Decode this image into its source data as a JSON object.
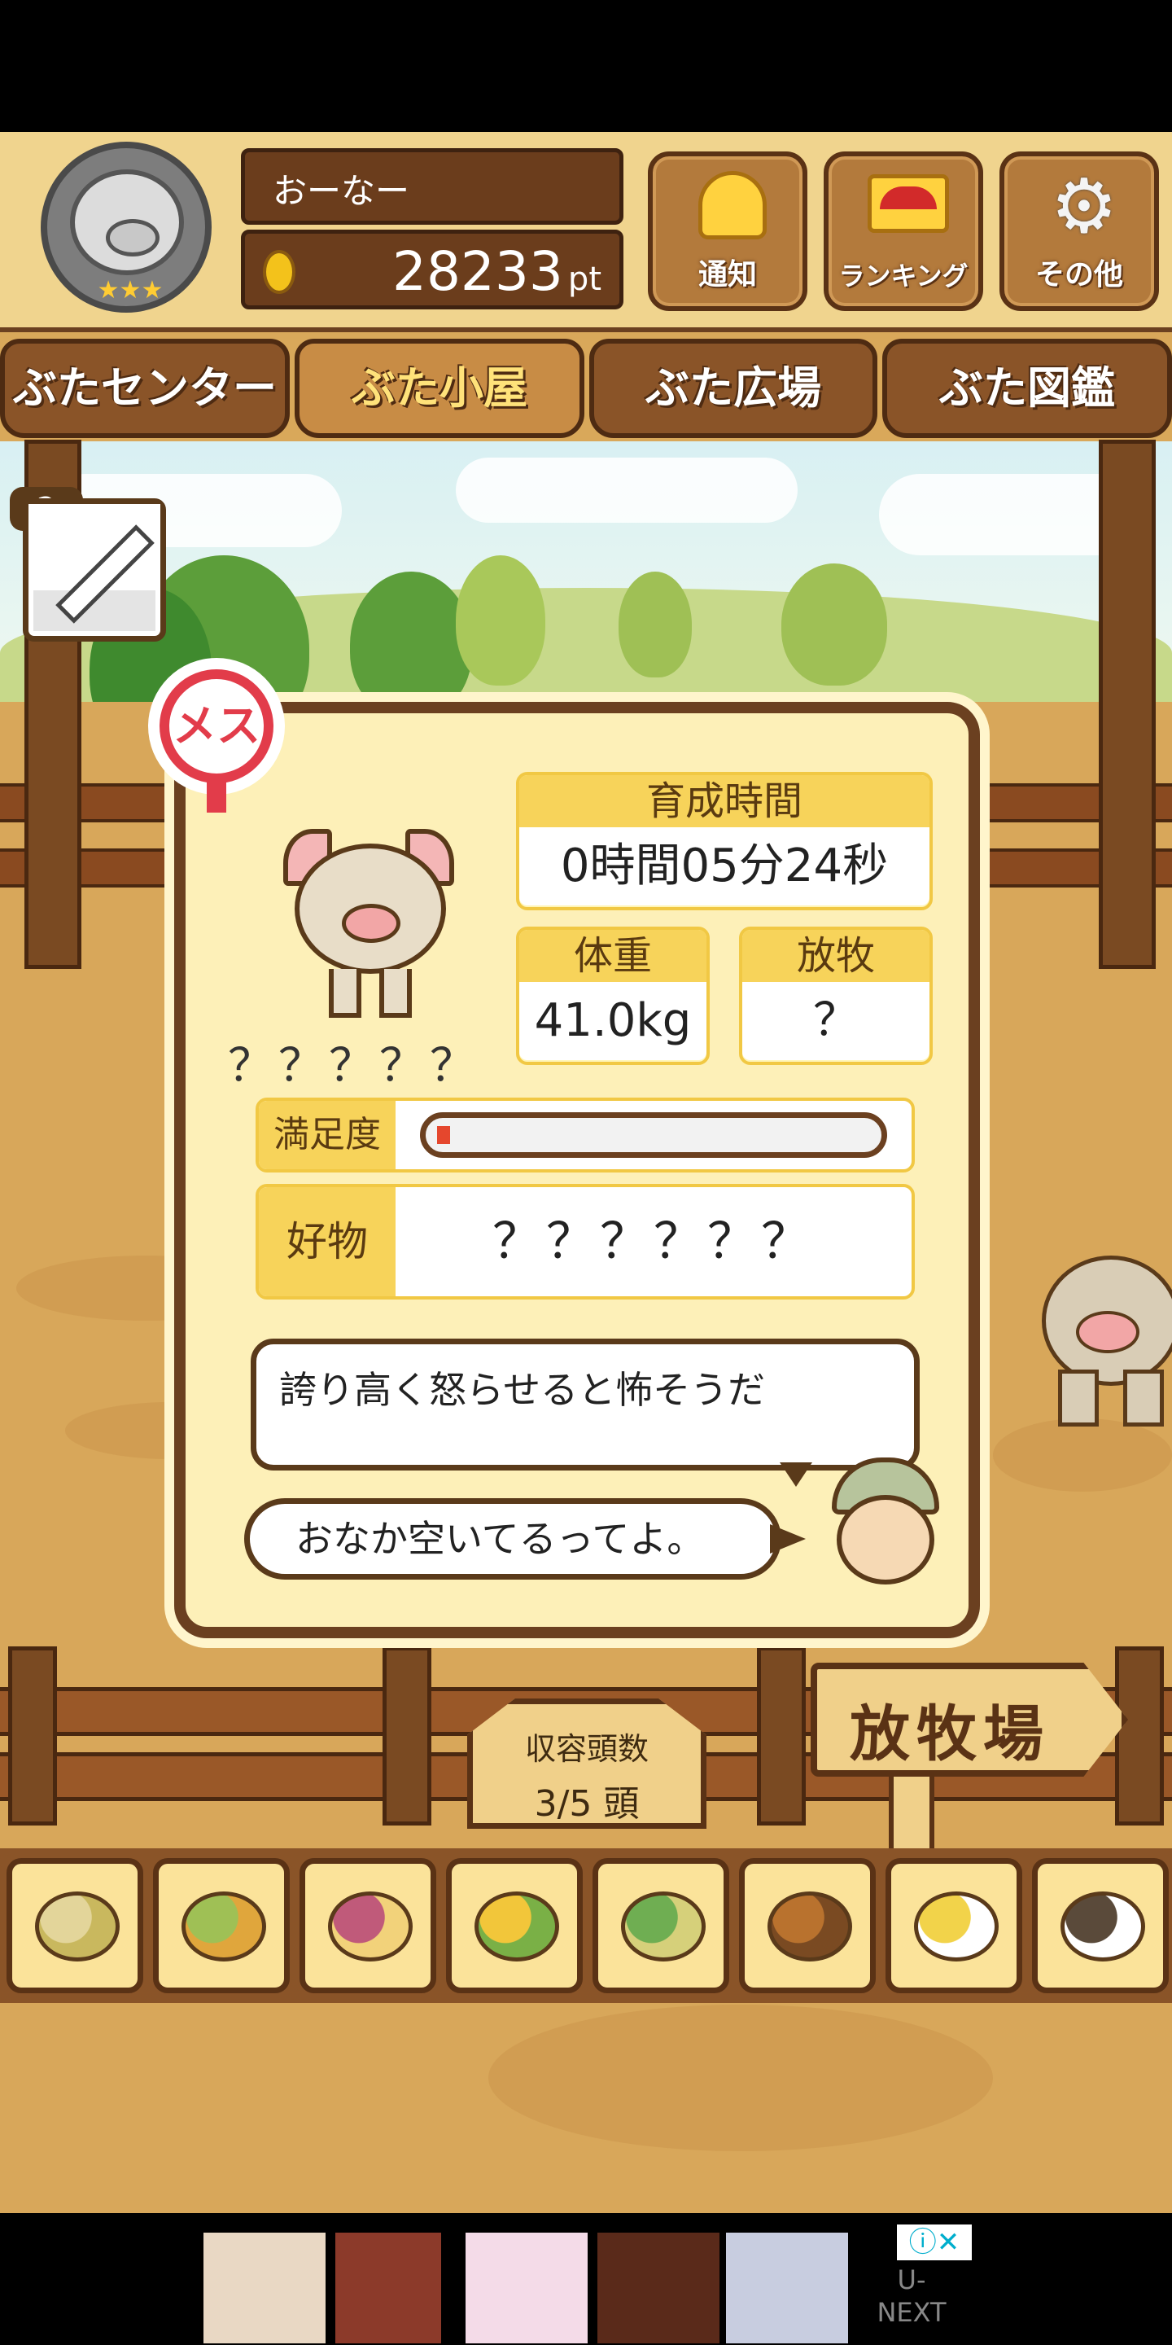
{
  "header": {
    "player_name": "おーなー",
    "points": "28233",
    "points_unit": "pt",
    "buttons": [
      {
        "id": "notify",
        "label": "通知",
        "icon": "bell-icon"
      },
      {
        "id": "ranking",
        "label": "ランキング",
        "icon": "crown-icon"
      },
      {
        "id": "other",
        "label": "その他",
        "icon": "gear-icon"
      }
    ]
  },
  "tabs": [
    {
      "label": "ぶたセンター",
      "active": false
    },
    {
      "label": "ぶた小屋",
      "active": true
    },
    {
      "label": "ぶた広場",
      "active": false
    },
    {
      "label": "ぶた図鑑",
      "active": false
    }
  ],
  "syringe_count": "2",
  "pig": {
    "gender_label": "メス",
    "name": "？？？？？",
    "raise_time_label": "育成時間",
    "raise_time_value": "0時間05分24秒",
    "weight_label": "体重",
    "weight_value": "41.0kg",
    "graze_label": "放牧",
    "graze_value": "？",
    "satisfaction_label": "満足度",
    "satisfaction_level": 0.03,
    "favorite_label": "好物",
    "favorite_value": "？？？？？？",
    "description": "誇り高く怒らせると怖そうだ",
    "farmer_comment": "おなか空いてるってよ。"
  },
  "pasture_sign": "放牧場",
  "capacity": {
    "label": "収容頭数",
    "value": "3/5 頭"
  },
  "foods": [
    "beans-icon",
    "mixed-beans-icon",
    "sweet-potato-icon",
    "corn-icon",
    "acorn-leaf-icon",
    "acorn-icon",
    "grain-plate-icon",
    "truffle-plate-icon"
  ],
  "ad": {
    "brand": "U-\nNEXT"
  },
  "colors": {
    "wood_dark": "#6b4020",
    "panel_bg": "#fdf0b8",
    "accent_yellow": "#f7d35a",
    "gender_red": "#e23c4a"
  }
}
